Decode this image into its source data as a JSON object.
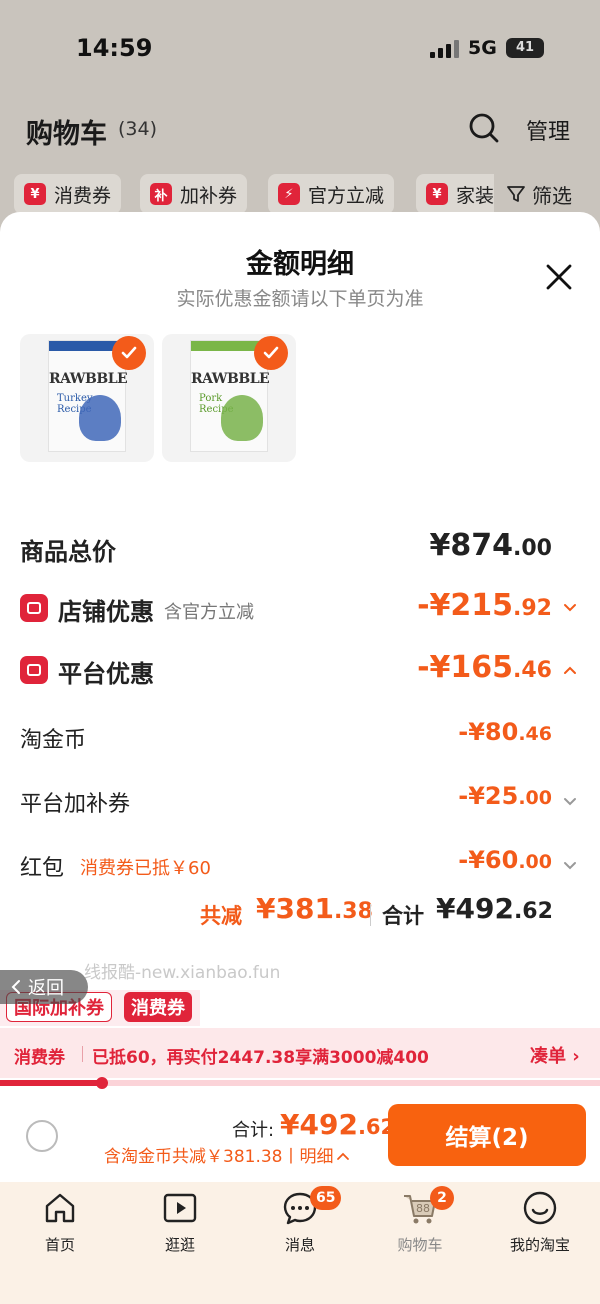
{
  "status_bar": {
    "time": "14:59",
    "network": "5G",
    "battery": "41",
    "battery_level": 0.41
  },
  "cart_header": {
    "title": "购物车",
    "count": "(34)",
    "manage_label": "管理"
  },
  "filter_chips": [
    {
      "icon_text": "¥",
      "label": "消费券"
    },
    {
      "icon_text": "补",
      "label": "加补券"
    },
    {
      "icon_text": "⚡",
      "label": "官方立减"
    },
    {
      "icon_text": "¥",
      "label": "家装"
    }
  ],
  "filter_button_label": "筛选",
  "sheet": {
    "title": "金额明细",
    "subtitle": "实际优惠金额请以下单页为准",
    "products": [
      {
        "brand": "RAWBBLE",
        "name_line1": "Turkey",
        "name_line2": "Recipe",
        "band_color": "#2a5aa8",
        "art_color": "#3f67b8"
      },
      {
        "brand": "RAWBBLE",
        "name_line1": "Pork",
        "name_line2": "Recipe",
        "band_color": "#7ab648",
        "art_color": "#78b24a"
      }
    ],
    "rows": {
      "goods_total": {
        "label": "商品总价",
        "int": "¥874",
        "dec": ".00"
      },
      "store_discount": {
        "label": "店铺优惠",
        "note": "含官方立减",
        "int": "-¥215",
        "dec": ".92"
      },
      "platform_discount": {
        "label": "平台优惠",
        "int": "-¥165",
        "dec": ".46"
      },
      "taojinbi": {
        "label": "淘金币",
        "int": "-¥80",
        "dec": ".46"
      },
      "platform_bonus": {
        "label": "平台加补券",
        "int": "-¥25",
        "dec": ".00"
      },
      "red_packet": {
        "label": "红包",
        "note": "消费券已抵￥60",
        "int": "-¥60",
        "dec": ".00"
      }
    },
    "total_reduce_label": "共减",
    "total_reduce_int": "¥381",
    "total_reduce_dec": ".38",
    "total_sum_label": "合计",
    "total_sum_int": "¥492",
    "total_sum_dec": ".62",
    "watermark": "线报酷-new.xianbao.fun"
  },
  "back_label": "返回",
  "tags": {
    "outline": "国际加补券",
    "solid": "消费券"
  },
  "promo": {
    "label": "消费券",
    "text": "已抵60，再实付2447.38享满3000减400",
    "link": "凑单",
    "progress": 0.17
  },
  "checkout": {
    "total_label": "合计:",
    "total_int": "¥492",
    "total_dec": ".62",
    "detail": "含淘金币共减￥381.38丨明细",
    "button": "结算(2)"
  },
  "tabbar": [
    {
      "icon": "home-icon",
      "label": "首页"
    },
    {
      "icon": "play-icon",
      "label": "逛逛"
    },
    {
      "icon": "chat-icon",
      "label": "消息",
      "badge": "65"
    },
    {
      "icon": "cart-icon",
      "label": "购物车",
      "badge": "2",
      "cart_count": "88"
    },
    {
      "icon": "face-icon",
      "label": "我的淘宝"
    }
  ]
}
